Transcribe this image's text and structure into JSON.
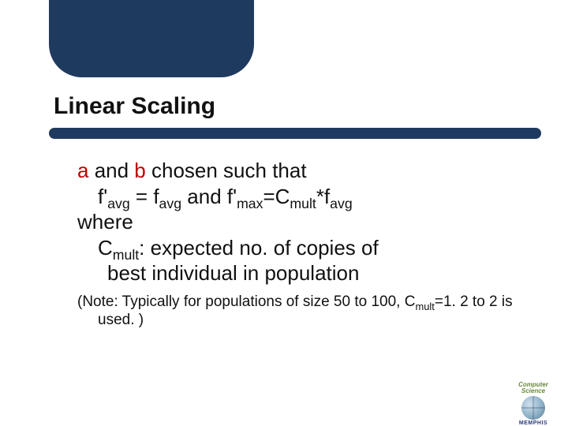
{
  "slide": {
    "title": "Linear Scaling",
    "line1": {
      "a": "a",
      "mid": " and ",
      "b": "b",
      "rest": " chosen such that"
    },
    "line2": {
      "full": "f'avg = favg and f'max=Cmult*favg",
      "fprime": "f'",
      "avg": "avg",
      "eq1": " = f",
      "and": " and f'",
      "max": "max",
      "eqC": "=C",
      "mult": "mult",
      "star": "*f"
    },
    "where": "where",
    "line4": {
      "C": "C",
      "mult": "mult",
      "rest1": ": expected no. of copies of",
      "rest2": "best individual in population"
    },
    "note": {
      "label": "(Note:",
      "part1": " Typically for populations of size 50 to 100, C",
      "mult": "mult",
      "part2": "=1. 2 to 2 is",
      "part3": "used. )"
    }
  },
  "logo": {
    "top": "Computer Science",
    "bottom": "MEMPHIS"
  }
}
